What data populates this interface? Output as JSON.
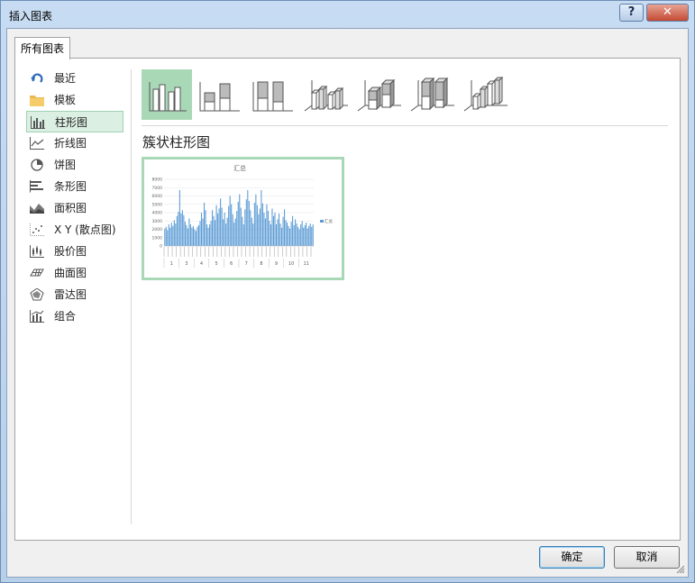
{
  "window": {
    "title": "插入图表",
    "help_label": "?",
    "close_label": "✕"
  },
  "tabs": [
    {
      "label": "所有图表",
      "active": true
    }
  ],
  "sidebar": {
    "items": [
      {
        "label": "最近",
        "icon": "recent-icon"
      },
      {
        "label": "模板",
        "icon": "folder-icon"
      },
      {
        "label": "柱形图",
        "icon": "column-chart-icon",
        "selected": true
      },
      {
        "label": "折线图",
        "icon": "line-chart-icon"
      },
      {
        "label": "饼图",
        "icon": "pie-chart-icon"
      },
      {
        "label": "条形图",
        "icon": "bar-chart-icon"
      },
      {
        "label": "面积图",
        "icon": "area-chart-icon"
      },
      {
        "label": "X Y (散点图)",
        "icon": "scatter-chart-icon"
      },
      {
        "label": "股价图",
        "icon": "stock-chart-icon"
      },
      {
        "label": "曲面图",
        "icon": "surface-chart-icon"
      },
      {
        "label": "雷达图",
        "icon": "radar-chart-icon"
      },
      {
        "label": "组合",
        "icon": "combo-chart-icon"
      }
    ]
  },
  "subtypes": [
    {
      "name": "clustered-column-subtype",
      "selected": true
    },
    {
      "name": "stacked-column-subtype"
    },
    {
      "name": "100-stacked-column-subtype"
    },
    {
      "name": "3d-clustered-column-subtype"
    },
    {
      "name": "3d-stacked-column-subtype"
    },
    {
      "name": "3d-100-stacked-column-subtype"
    },
    {
      "name": "3d-column-subtype"
    }
  ],
  "selected_chart_title": "簇状柱形图",
  "chart_data": {
    "type": "bar",
    "title": "汇总",
    "legend": "汇总",
    "legend_position": "right",
    "ylim": [
      0,
      8000
    ],
    "yticks": [
      "0",
      "1000",
      "2000",
      "3000",
      "4000",
      "5000",
      "6000",
      "7000",
      "8000"
    ],
    "month_groups": [
      "1",
      "3",
      "4",
      "5",
      "6",
      "7",
      "8",
      "9",
      "10",
      "11"
    ],
    "values": [
      2100,
      2300,
      1900,
      2600,
      2200,
      2800,
      2400,
      3100,
      2700,
      3600,
      4100,
      6700,
      3900,
      4300,
      3700,
      2900,
      2500,
      2100,
      3300,
      2600,
      2200,
      2400,
      2000,
      1800,
      2300,
      2500,
      3000,
      4000,
      3300,
      5200,
      4300,
      2600,
      2200,
      2600,
      3000,
      4300,
      3600,
      3100,
      4900,
      3900,
      4500,
      5700,
      4600,
      3200,
      4000,
      2700,
      3400,
      4800,
      6000,
      5000,
      3800,
      2800,
      3300,
      4200,
      5300,
      6200,
      4600,
      3500,
      2600,
      4400,
      5600,
      6700,
      5400,
      4300,
      3400,
      2700,
      5200,
      6200,
      4900,
      3800,
      4500,
      6700,
      5100,
      4000,
      3300,
      5000,
      4200,
      3000,
      2600,
      4500,
      3600,
      4000,
      2600,
      3200,
      3900,
      2700,
      2200,
      3500,
      4400,
      3100,
      2800,
      2400,
      2100,
      2900,
      3600,
      2500,
      3200,
      2700,
      2300,
      2000,
      2600,
      3000,
      2200,
      2500,
      2800,
      2100,
      2400,
      2700,
      2300,
      2600
    ]
  },
  "buttons": {
    "ok": "确定",
    "cancel": "取消"
  }
}
